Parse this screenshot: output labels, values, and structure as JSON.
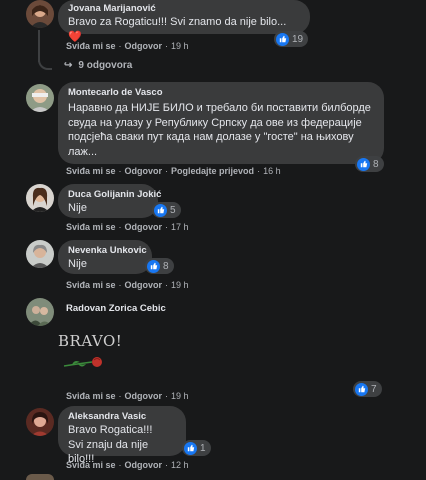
{
  "comments": [
    {
      "author": "Jovana Marijanović",
      "text": "Bravo za Rogaticu!!! Svi znamo da nije bilo... ❤️",
      "like": "Sviđa mi se",
      "reply": "Odgovor",
      "time": "19 h",
      "reactions": "19",
      "replies": "9 odgovora"
    },
    {
      "author": "Montecarlo de Vasco",
      "text": "Наравно да НИЈЕ БИЛО и требало би поставити билборде\nсвуда на улазу у Републику Српску да ове из федерације\nподсјећа сваки пут када нам долазе у \"госте\" на њихову\nлаж...",
      "like": "Sviđa mi se",
      "reply": "Odgovor",
      "translate": "Pogledajte prijevod",
      "time": "16 h",
      "reactions": "8"
    },
    {
      "author": "Duca Golijanin Jokić",
      "text": "Nije",
      "like": "Sviđa mi se",
      "reply": "Odgovor",
      "time": "17 h",
      "reactions": "5"
    },
    {
      "author": "Nevenka Unkovic",
      "text": "Nije",
      "like": "Sviđa mi se",
      "reply": "Odgovor",
      "time": "19 h",
      "reactions": "8"
    },
    {
      "author": "Radovan Zorica Cebic",
      "sticker_text": "BRAVO!",
      "like": "Sviđa mi se",
      "reply": "Odgovor",
      "time": "19 h",
      "reactions": "7"
    },
    {
      "author": "Aleksandra Vasic",
      "text": "Bravo Rogatica!!!\nSvi znaju da nije bilo!!!",
      "like": "Sviđa mi se",
      "reply": "Odgovor",
      "time": "12 h",
      "reactions": "1"
    }
  ],
  "colors": {
    "background": "#18191a",
    "bubble": "#3a3b3c",
    "like_blue": "#1877f2",
    "secondary_text": "#b0b3b8"
  }
}
